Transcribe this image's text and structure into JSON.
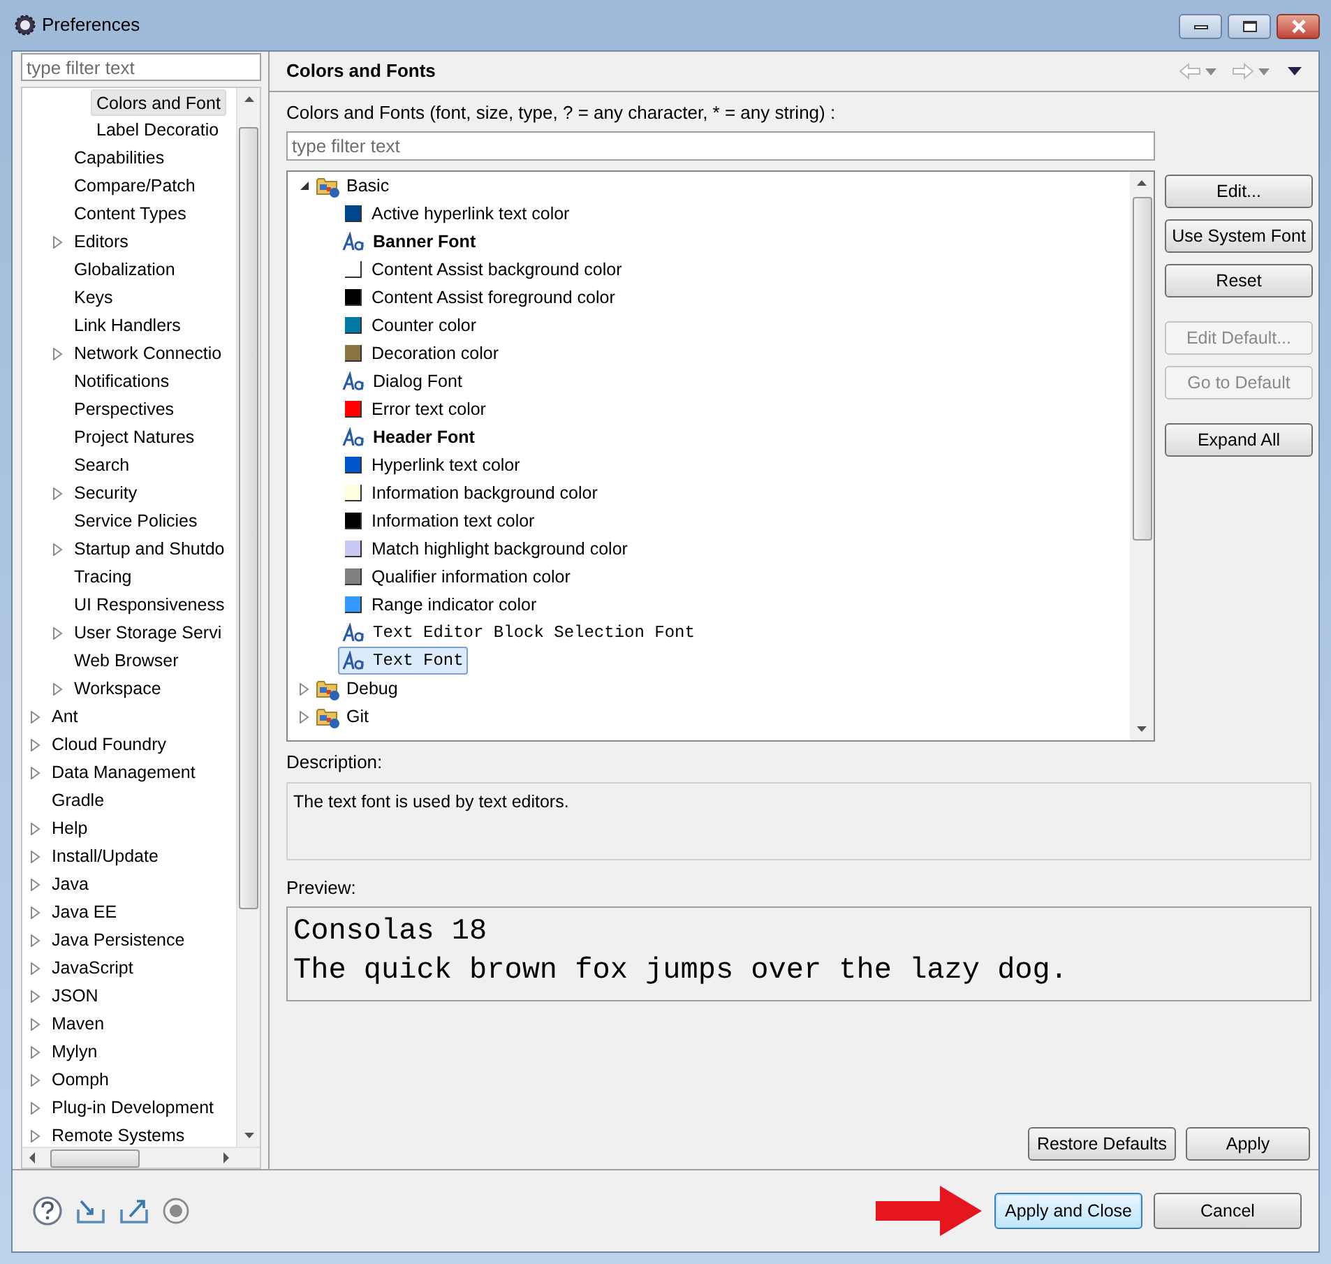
{
  "window": {
    "title": "Preferences"
  },
  "sidebar": {
    "filter": {
      "placeholder": "type filter text"
    },
    "tree": [
      {
        "children": [
          {
            "children": [
              {
                "label": "Colors and Font",
                "expandable": false,
                "selected": true
              },
              {
                "label": "Label Decoratio",
                "expandable": false,
                "selected": false
              }
            ]
          },
          {
            "label": "Capabilities",
            "expandable": false,
            "selected": false
          },
          {
            "label": "Compare/Patch",
            "expandable": false,
            "selected": false
          },
          {
            "label": "Content Types",
            "expandable": false,
            "selected": false
          },
          {
            "label": "Editors",
            "expandable": true,
            "selected": false
          },
          {
            "label": "Globalization",
            "expandable": false,
            "selected": false
          },
          {
            "label": "Keys",
            "expandable": false,
            "selected": false
          },
          {
            "label": "Link Handlers",
            "expandable": false,
            "selected": false
          },
          {
            "label": "Network Connectio",
            "expandable": true,
            "selected": false
          },
          {
            "label": "Notifications",
            "expandable": false,
            "selected": false
          },
          {
            "label": "Perspectives",
            "expandable": false,
            "selected": false
          },
          {
            "label": "Project Natures",
            "expandable": false,
            "selected": false
          },
          {
            "label": "Search",
            "expandable": false,
            "selected": false
          },
          {
            "label": "Security",
            "expandable": true,
            "selected": false
          },
          {
            "label": "Service Policies",
            "expandable": false,
            "selected": false
          },
          {
            "label": "Startup and Shutdo",
            "expandable": true,
            "selected": false
          },
          {
            "label": "Tracing",
            "expandable": false,
            "selected": false
          },
          {
            "label": "UI Responsiveness",
            "expandable": false,
            "selected": false
          },
          {
            "label": "User Storage Servi",
            "expandable": true,
            "selected": false
          },
          {
            "label": "Web Browser",
            "expandable": false,
            "selected": false
          },
          {
            "label": "Workspace",
            "expandable": true,
            "selected": false
          }
        ]
      },
      {
        "label": "Ant",
        "expandable": true,
        "selected": false
      },
      {
        "label": "Cloud Foundry",
        "expandable": true,
        "selected": false
      },
      {
        "label": "Data Management",
        "expandable": true,
        "selected": false
      },
      {
        "label": "Gradle",
        "expandable": false,
        "selected": false
      },
      {
        "label": "Help",
        "expandable": true,
        "selected": false
      },
      {
        "label": "Install/Update",
        "expandable": true,
        "selected": false
      },
      {
        "label": "Java",
        "expandable": true,
        "selected": false
      },
      {
        "label": "Java EE",
        "expandable": true,
        "selected": false
      },
      {
        "label": "Java Persistence",
        "expandable": true,
        "selected": false
      },
      {
        "label": "JavaScript",
        "expandable": true,
        "selected": false
      },
      {
        "label": "JSON",
        "expandable": true,
        "selected": false
      },
      {
        "label": "Maven",
        "expandable": true,
        "selected": false
      },
      {
        "label": "Mylyn",
        "expandable": true,
        "selected": false
      },
      {
        "label": "Oomph",
        "expandable": true,
        "selected": false
      },
      {
        "label": "Plug-in Development",
        "expandable": true,
        "selected": false
      },
      {
        "label": "Remote Systems",
        "expandable": true,
        "selected": false
      }
    ]
  },
  "page": {
    "title": "Colors and Fonts",
    "instructions": "Colors and Fonts (font, size, type, ? = any character, * = any string) :",
    "filter": {
      "placeholder": "type filter text"
    },
    "tree": [
      {
        "label": "Basic",
        "expanded": true,
        "selected": false,
        "children": [
          {
            "kind": "color",
            "label": "Active hyperlink text color",
            "color": "#00468c",
            "selected": false
          },
          {
            "kind": "boldfont",
            "label": "Banner Font",
            "selected": false
          },
          {
            "kind": "color",
            "label": "Content Assist background color",
            "color": "#ffffff",
            "selected": false
          },
          {
            "kind": "color",
            "label": "Content Assist foreground color",
            "color": "#000000",
            "selected": false
          },
          {
            "kind": "color",
            "label": "Counter color",
            "color": "#0079a5",
            "selected": false
          },
          {
            "kind": "color",
            "label": "Decoration color",
            "color": "#8b7442",
            "selected": false
          },
          {
            "kind": "font",
            "label": "Dialog Font",
            "selected": false
          },
          {
            "kind": "color",
            "label": "Error text color",
            "color": "#ff0000",
            "selected": false
          },
          {
            "kind": "boldfont",
            "label": "Header Font",
            "selected": false
          },
          {
            "kind": "color",
            "label": "Hyperlink text color",
            "color": "#0055cc",
            "selected": false
          },
          {
            "kind": "color",
            "label": "Information background color",
            "color": "#ffffe1",
            "selected": false
          },
          {
            "kind": "color",
            "label": "Information text color",
            "color": "#000000",
            "selected": false
          },
          {
            "kind": "color",
            "label": "Match highlight background color",
            "color": "#c8c8f0",
            "selected": false
          },
          {
            "kind": "color",
            "label": "Qualifier information color",
            "color": "#808080",
            "selected": false
          },
          {
            "kind": "color",
            "label": "Range indicator color",
            "color": "#3399ff",
            "selected": false
          },
          {
            "kind": "monofont",
            "label": "Text Editor Block Selection Font",
            "selected": false
          },
          {
            "kind": "monofont",
            "label": "Text Font",
            "selected": true
          }
        ]
      },
      {
        "label": "Debug",
        "expanded": false,
        "selected": false
      },
      {
        "label": "Git",
        "expanded": false,
        "selected": false
      }
    ],
    "side_buttons": [
      {
        "label": "Edit...",
        "disabled": false
      },
      {
        "label": "Use System Font",
        "disabled": false
      },
      {
        "label": "Reset",
        "disabled": false
      },
      {
        "label": "Edit Default...",
        "disabled": true
      },
      {
        "label": "Go to Default",
        "disabled": true
      },
      {
        "label": "Expand All",
        "disabled": false
      }
    ],
    "description_label": "Description:",
    "description": "The text font is used by text editors.",
    "preview_label": "Preview:",
    "preview": [
      "Consolas 18",
      "The quick brown fox jumps over the lazy dog."
    ],
    "buttons": [
      "Restore Defaults",
      "Apply"
    ]
  },
  "footer": {
    "buttons": [
      {
        "label": "Apply and Close",
        "default": true
      },
      {
        "label": "Cancel",
        "default": false
      }
    ]
  }
}
